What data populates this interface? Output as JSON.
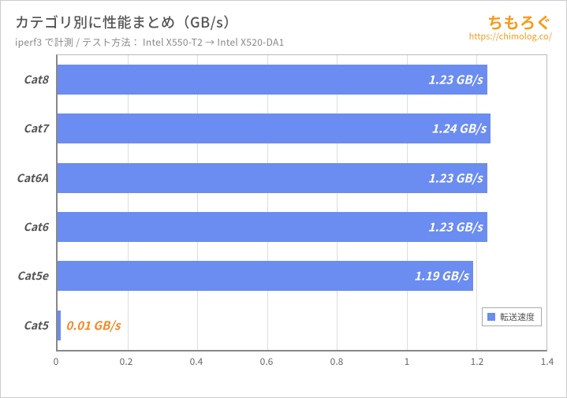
{
  "header": {
    "title": "カテゴリ別に性能まとめ（GB/s）",
    "subtitle": "iperf3 で計測 / テスト方法： Intel X550-T2 → Intel X520-DA1"
  },
  "brand": {
    "logo": "ちもろぐ",
    "url": "https://chimolog.co/"
  },
  "legend": {
    "series": "転送速度"
  },
  "chart_data": {
    "type": "bar",
    "orientation": "horizontal",
    "title": "カテゴリ別に性能まとめ（GB/s）",
    "xlabel": "",
    "ylabel": "",
    "xlim": [
      0,
      1.4
    ],
    "xticks": [
      0,
      0.2,
      0.4,
      0.6,
      0.8,
      1,
      1.2,
      1.4
    ],
    "categories": [
      "Cat8",
      "Cat7",
      "Cat6A",
      "Cat6",
      "Cat5e",
      "Cat5"
    ],
    "series": [
      {
        "name": "転送速度",
        "values": [
          1.23,
          1.24,
          1.23,
          1.23,
          1.19,
          0.01
        ],
        "value_labels": [
          "1.23 GB/s",
          "1.24 GB/s",
          "1.23 GB/s",
          "1.23 GB/s",
          "1.19 GB/s",
          "0.01 GB/s"
        ]
      }
    ],
    "highlight_index": 5,
    "color": "#6b8cf0",
    "highlight_color": "#f0892a"
  }
}
